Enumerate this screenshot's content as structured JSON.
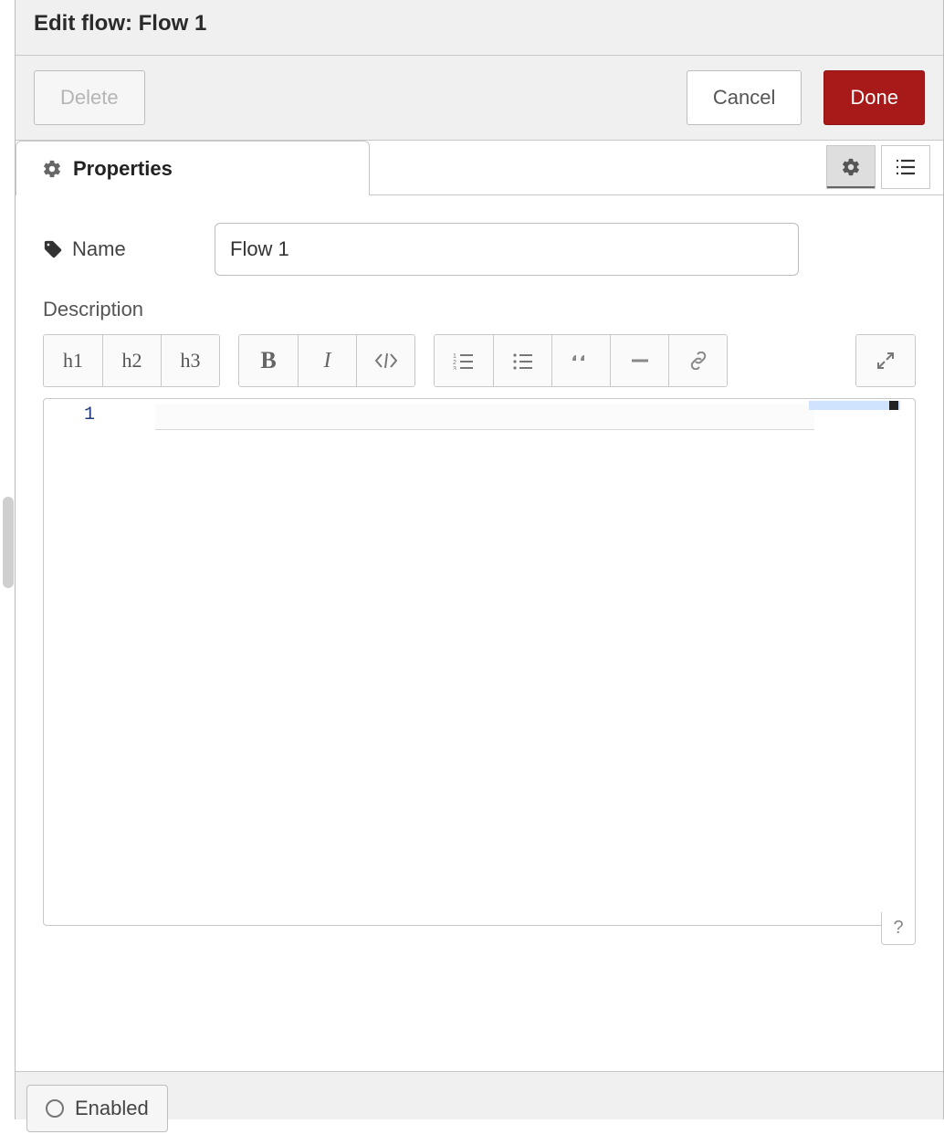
{
  "header": {
    "title": "Edit flow: Flow 1"
  },
  "actions": {
    "delete": "Delete",
    "cancel": "Cancel",
    "done": "Done"
  },
  "tabs": {
    "properties": "Properties"
  },
  "form": {
    "name_label": "Name",
    "name_value": "Flow 1",
    "description_label": "Description"
  },
  "toolbar": {
    "h1": "h1",
    "h2": "h2",
    "h3": "h3",
    "bold": "B",
    "italic": "I"
  },
  "editor": {
    "first_line_number": "1",
    "help": "?"
  },
  "footer": {
    "enabled": "Enabled"
  }
}
